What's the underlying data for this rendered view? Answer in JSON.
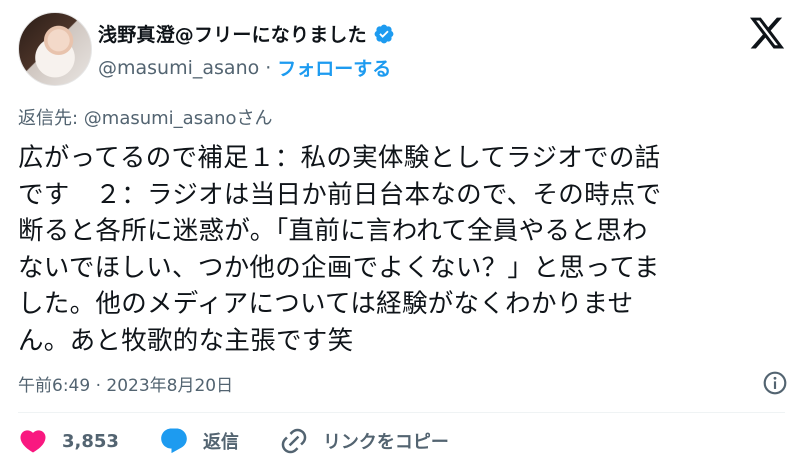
{
  "author": {
    "display_name": "浅野真澄@フリーになりました",
    "handle": "@masumi_asano",
    "separator": "·",
    "follow_label": "フォローする"
  },
  "reply_to": "返信先: @masumi_asanoさん",
  "tweet": {
    "text": "広がってるので補足１：私の実体験としてラジオでの話\nです　２：ラジオは当日か前日台本なので、その時点で\n断ると各所に迷惑が。「直前に言われて全員やると思わ\nないでほしい、つか他の企画でよくない？」と思ってま\nした。他のメディアについては経験がなくわかりませ\nん。あと牧歌的な主張です笑",
    "timestamp": "午前6:49 · 2023年8月20日"
  },
  "actions": {
    "like_count": "3,853",
    "reply_label": "返信",
    "copy_link_label": "リンクをコピー"
  },
  "colors": {
    "like": "#f91880",
    "reply": "#1d9bf0",
    "verified": "#1d9bf0",
    "secondary_text": "#536471"
  },
  "icons": [
    "verified-badge-icon",
    "x-logo-icon",
    "info-icon",
    "heart-icon",
    "reply-bubble-icon",
    "link-icon"
  ]
}
